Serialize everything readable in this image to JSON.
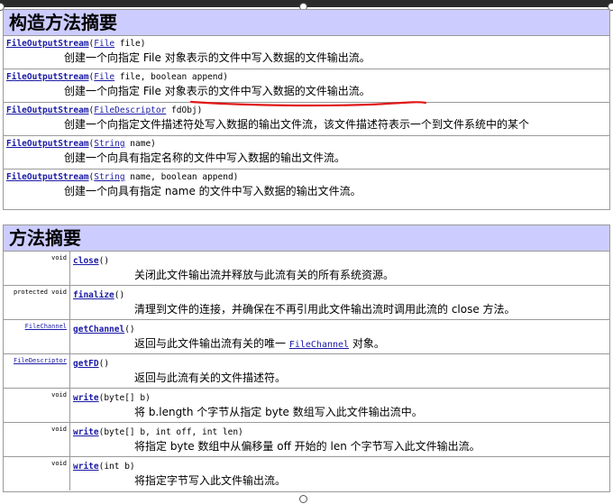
{
  "constructor_summary": {
    "title": "构造方法摘要",
    "rows": [
      {
        "name": "FileOutputStream",
        "open": "(",
        "ptype": "File",
        "params": " file)",
        "desc": "创建一个向指定 File 对象表示的文件中写入数据的文件输出流。"
      },
      {
        "name": "FileOutputStream",
        "open": "(",
        "ptype": "File",
        "params": " file, boolean append)",
        "desc": "创建一个向指定 File 对象表示的文件中写入数据的文件输出流。"
      },
      {
        "name": "FileOutputStream",
        "open": "(",
        "ptype": "FileDescriptor",
        "params": " fdObj)",
        "desc": "创建一个向指定文件描述符处写入数据的输出文件流，该文件描述符表示一个到文件系统中的某个"
      },
      {
        "name": "FileOutputStream",
        "open": "(",
        "ptype": "String",
        "params": " name)",
        "desc": "创建一个向具有指定名称的文件中写入数据的输出文件流。"
      },
      {
        "name": "FileOutputStream",
        "open": "(",
        "ptype": "String",
        "params": " name, boolean append)",
        "desc": "创建一个向具有指定 name 的文件中写入数据的输出文件流。"
      }
    ]
  },
  "method_summary": {
    "title": "方法摘要",
    "rows": [
      {
        "type": "void",
        "name": "close",
        "params": "()",
        "desc": "关闭此文件输出流并释放与此流有关的所有系统资源。"
      },
      {
        "type": "protected  void",
        "name": "finalize",
        "params": "()",
        "desc": "清理到文件的连接，并确保在不再引用此文件输出流时调用此流的 close 方法。"
      },
      {
        "type": "FileChannel",
        "name": "getChannel",
        "params": "()",
        "desc_before": "返回与此文件输出流有关的唯一 ",
        "desc_link": "FileChannel",
        "desc_after": " 对象。"
      },
      {
        "type": "FileDescriptor",
        "name": "getFD",
        "params": "()",
        "desc": "返回与此流有关的文件描述符。"
      },
      {
        "type": "void",
        "name": "write",
        "params": "(byte[] b)",
        "desc": "将 b.length 个字节从指定 byte 数组写入此文件输出流中。"
      },
      {
        "type": "void",
        "name": "write",
        "params": "(byte[] b, int off, int len)",
        "desc": "将指定 byte 数组中从偏移量 off 开始的 len 个字节写入此文件输出流。"
      },
      {
        "type": "void",
        "name": "write",
        "params": "(int b)",
        "desc": "将指定字节写入此文件输出流。"
      }
    ]
  },
  "colors": {
    "header_bg": "#ccccff",
    "link": "#1a1aa6",
    "annotation_underline": "#e01818"
  }
}
